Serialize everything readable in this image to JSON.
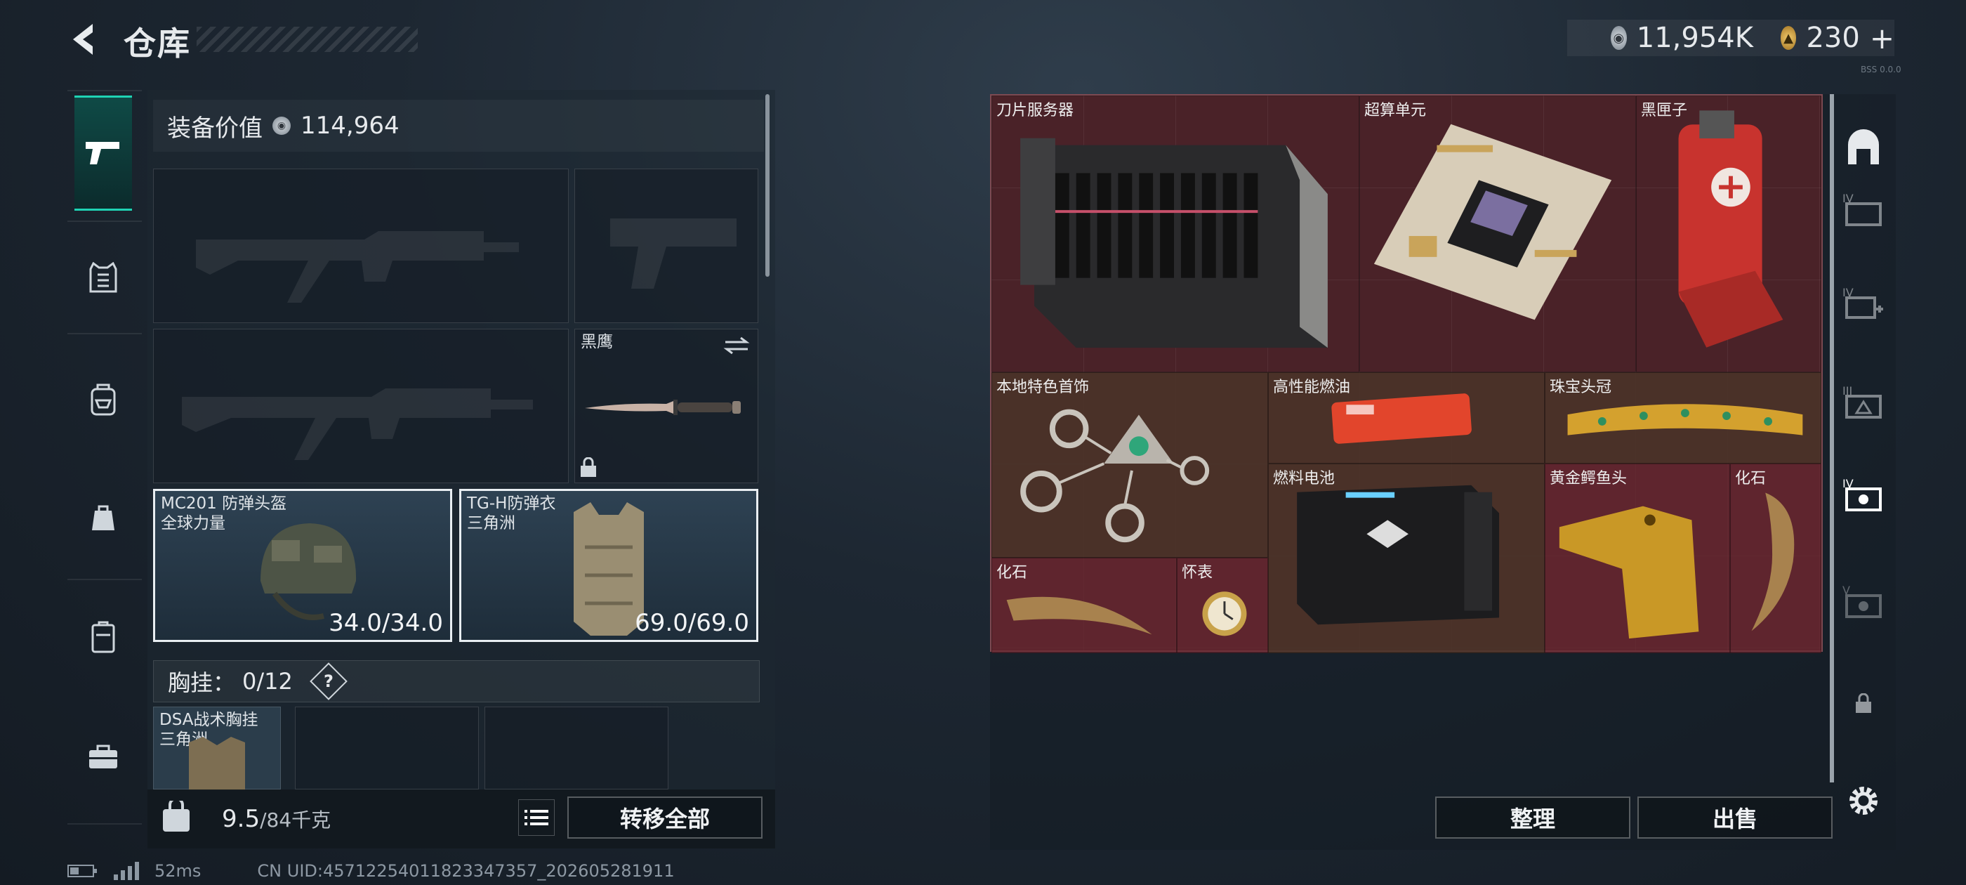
{
  "header": {
    "title": "仓库",
    "currency": {
      "silver_value": "11,954K",
      "gold_value": "230",
      "gold_add": "+"
    },
    "tiny_id": "BSS 0.0.0"
  },
  "left_nav": {
    "items": [
      {
        "name": "weapons",
        "icon": "pistol-icon",
        "active": true
      },
      {
        "name": "armor",
        "icon": "vest-icon"
      },
      {
        "name": "backpack",
        "icon": "backpack-icon"
      },
      {
        "name": "bag",
        "icon": "pouch-icon"
      },
      {
        "name": "case",
        "icon": "case-icon"
      },
      {
        "name": "toolbox",
        "icon": "toolbox-icon"
      }
    ]
  },
  "equipment": {
    "value_label": "装备价值",
    "value": "114,964",
    "slots": {
      "melee": {
        "name": "黑鹰"
      },
      "helmet": {
        "name": "MC201 防弹头盔",
        "sub": "全球力量",
        "durability": "34.0/34.0"
      },
      "armor": {
        "name": "TG-H防弹衣",
        "sub": "三角洲",
        "durability": "69.0/69.0"
      }
    },
    "chest_rig": {
      "label": "胸挂：",
      "count": "0/12",
      "help": "?"
    },
    "rig_item": {
      "name": "DSA战术胸挂",
      "sub": "三角洲"
    },
    "weight": {
      "current": "9.5",
      "capacity": "/84千克"
    },
    "transfer_all": "转移全部"
  },
  "storage": {
    "items": [
      {
        "name": "刀片服务器"
      },
      {
        "name": "超算单元"
      },
      {
        "name": "黑匣子"
      },
      {
        "name": "本地特色首饰"
      },
      {
        "name": "高性能燃油"
      },
      {
        "name": "珠宝头冠"
      },
      {
        "name": "燃料电池"
      },
      {
        "name": "黄金鳄鱼头"
      },
      {
        "name": "化石"
      },
      {
        "name": "化石"
      },
      {
        "name": "怀表"
      }
    ],
    "sort_button": "整理",
    "sell_button": "出售"
  },
  "footer": {
    "ping": "52ms",
    "uid": "CN UID:45712254011823347357_202605281911"
  },
  "colors": {
    "accent": "#1fd3b4",
    "storage_bg": "#4a2228"
  }
}
